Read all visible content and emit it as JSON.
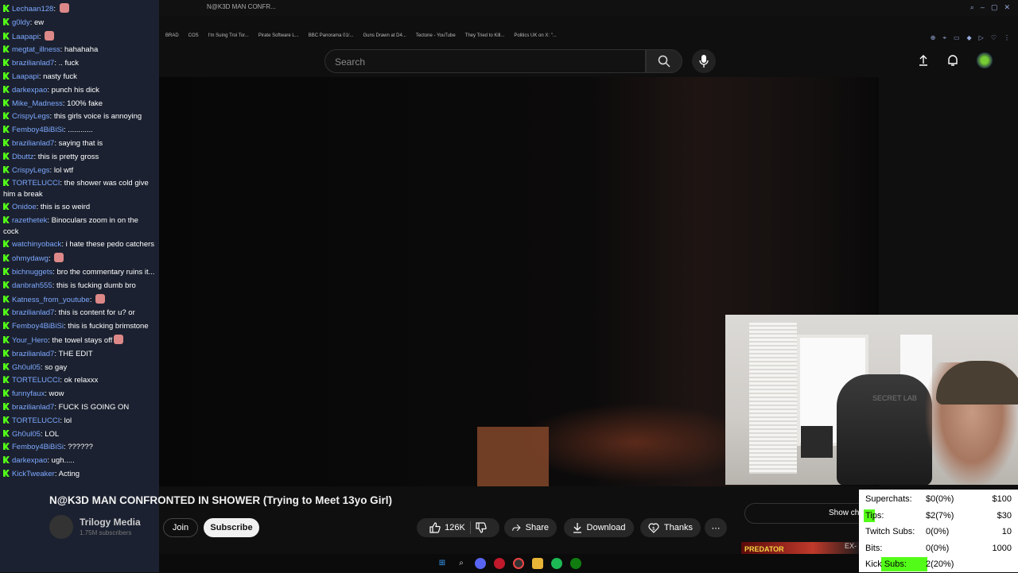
{
  "browser": {
    "tab_title": "N@K3D MAN CONFR...",
    "bookmarks": [
      "BRAD",
      "COS",
      "I'm Suing Troi Tor...",
      "Pirate Software L...",
      "BBC Panorama 01/...",
      "Guns Drawn at D4...",
      "Tectone - YouTube",
      "They Tried to Kill...",
      "Politics UK on X: \"..."
    ]
  },
  "youtube": {
    "search_placeholder": "Search",
    "video_title": "N@K3D MAN CONFRONTED IN SHOWER (Trying to Meet 13yo Girl)",
    "channel_name": "Trilogy Media",
    "subscribers": "1.75M subscribers",
    "join_label": "Join",
    "subscribe_label": "Subscribe",
    "likes": "126K",
    "share_label": "Share",
    "download_label": "Download",
    "thanks_label": "Thanks",
    "show_chat_label": "Show ch",
    "promo_label": "PREDATOR",
    "promo_label2": "EX-"
  },
  "chat": [
    {
      "user": "Lechaan128",
      "text": "",
      "emote": true
    },
    {
      "user": "g0ldy",
      "text": "ew"
    },
    {
      "user": "Laapapi",
      "text": "",
      "emote": true
    },
    {
      "user": "megtat_illness",
      "text": "hahahaha"
    },
    {
      "user": "brazilianlad7",
      "text": ".. fuck"
    },
    {
      "user": "Laapapi",
      "text": "nasty fuck"
    },
    {
      "user": "darkexpao",
      "text": "punch his dick"
    },
    {
      "user": "Mike_Madness",
      "text": "100% fake"
    },
    {
      "user": "CrispyLegs",
      "text": "this girls voice is annoying"
    },
    {
      "user": "Femboy4BiBiSi",
      "text": "............"
    },
    {
      "user": "brazilianlad7",
      "text": "saying that is"
    },
    {
      "user": "Dbuttz",
      "text": "this is pretty gross"
    },
    {
      "user": "CrispyLegs",
      "text": "lol wtf"
    },
    {
      "user": "TORTELUCCI",
      "text": "the shower was cold give him a break"
    },
    {
      "user": "Onidoe",
      "text": "this is so weird"
    },
    {
      "user": "razethetek",
      "text": "Binoculars zoom in on the cock"
    },
    {
      "user": "watchinyoback",
      "text": "i hate these pedo catchers"
    },
    {
      "user": "ohmydawg",
      "text": "",
      "emote": true
    },
    {
      "user": "bichnuggets",
      "text": "bro the commentary ruins it..."
    },
    {
      "user": "danbrah555",
      "text": "this is fucking dumb bro"
    },
    {
      "user": "Katness_from_youtube",
      "text": "",
      "emote": true
    },
    {
      "user": "brazilianlad7",
      "text": "this is content for u? or"
    },
    {
      "user": "Femboy4BiBiSi",
      "text": "this is fucking brimstone"
    },
    {
      "user": "Your_Hero",
      "text": "the towel stays off",
      "emote": true
    },
    {
      "user": "brazilianlad7",
      "text": "THE EDIT"
    },
    {
      "user": "Gh0ul05",
      "text": "so gay"
    },
    {
      "user": "TORTELUCCI",
      "text": "ok relaxxx"
    },
    {
      "user": "funnyfaux",
      "text": "wow"
    },
    {
      "user": "brazilianlad7",
      "text": "FUCK IS GOING ON"
    },
    {
      "user": "TORTELUCCI",
      "text": "lol"
    },
    {
      "user": "Gh0ul05",
      "text": "LOL"
    },
    {
      "user": "Femboy4BiBiSi",
      "text": "??????"
    },
    {
      "user": "darkexpao",
      "text": "ugh....."
    },
    {
      "user": "KickTweaker",
      "text": "Acting"
    }
  ],
  "stats": {
    "rows": [
      {
        "label": "Superchats:",
        "value": "$0(0%)",
        "goal": "$100"
      },
      {
        "label": "Tips:",
        "value": "$2(7%)",
        "goal": "$30"
      },
      {
        "label": "Twitch Subs:",
        "value": "0(0%)",
        "goal": "10"
      },
      {
        "label": "Bits:",
        "value": "0(0%)",
        "goal": "1000"
      },
      {
        "label": "Kick Subs:",
        "value": "2(20%)",
        "goal": ""
      }
    ],
    "highlight_color": "#53fc18"
  },
  "webcam": {
    "chair_brand": "SECRET LAB"
  }
}
